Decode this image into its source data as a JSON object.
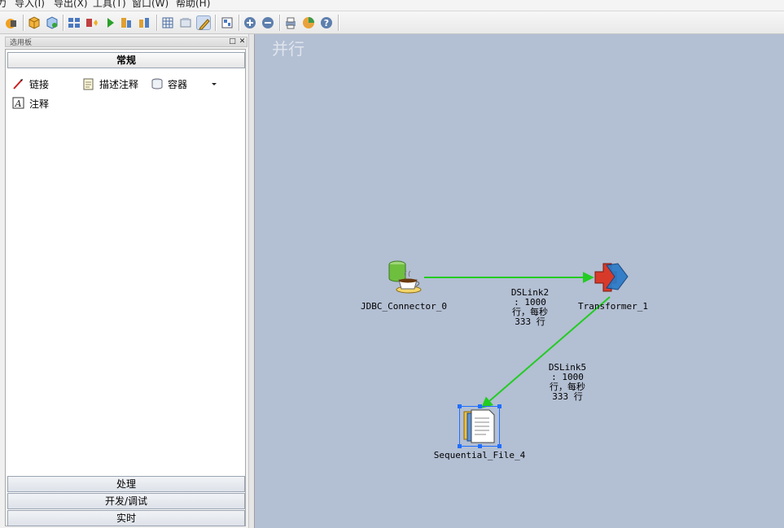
{
  "menubar": {
    "items": [
      "力",
      "导入(I)",
      "导出(X)",
      "工具(T)",
      "窗口(W)",
      "帮助(H)"
    ]
  },
  "toolbar": {
    "icons": [
      "palette-icon",
      "repository-icon",
      "compile-icon",
      "run-icon",
      "job-log-icon",
      "grid-icon",
      "link-icon",
      "pencil-icon",
      "layout-icon",
      "zoom-in-icon",
      "zoom-out-icon",
      "print-icon",
      "chart-icon",
      "help-icon"
    ]
  },
  "palette": {
    "title": "选用板",
    "categories": {
      "general": "常规",
      "processing": "处理",
      "dev_debug": "开发/调试",
      "realtime": "实时"
    },
    "items": {
      "link": "链接",
      "describe_annotation": "描述注释",
      "container": "容器",
      "annotation": "注释"
    }
  },
  "canvas": {
    "title": "并行",
    "stages": {
      "jdbc": "JDBC_Connector_0",
      "transformer": "Transformer_1",
      "seqfile": "Sequential_File_4"
    },
    "links": {
      "dslink2": {
        "line1": "DSLink2",
        "line2": ": 1000",
        "line3": "行，每秒",
        "line4": "333 行"
      },
      "dslink5": {
        "line1": "DSLink5",
        "line2": ": 1000",
        "line3": "行，每秒",
        "line4": "333 行"
      }
    },
    "colors": {
      "background": "#b3bfd3",
      "link": "#22cc22",
      "selection": "#1f6fff"
    }
  }
}
